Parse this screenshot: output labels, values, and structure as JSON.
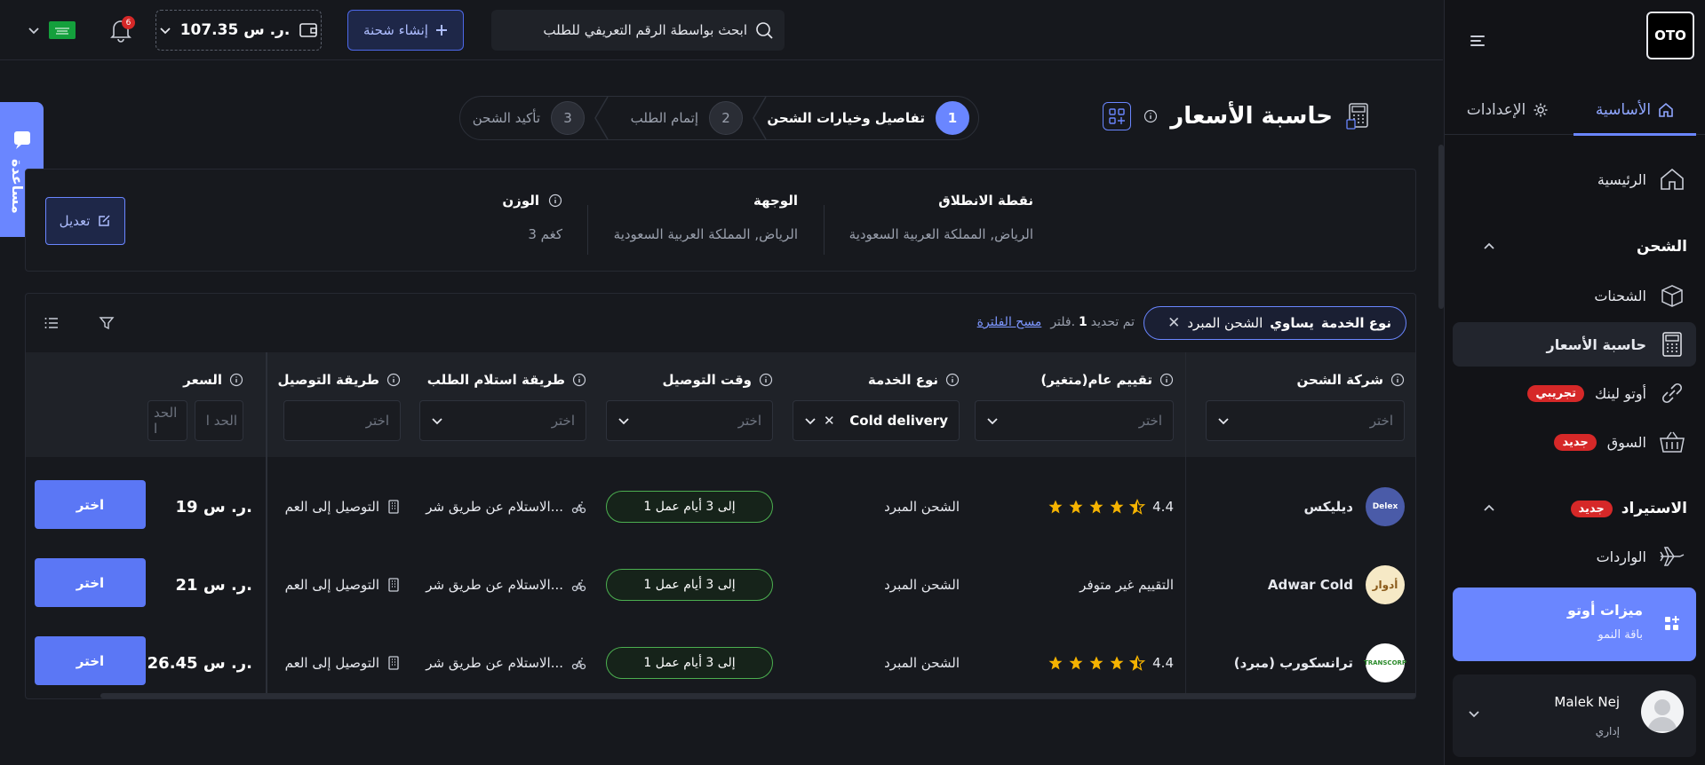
{
  "brand": {
    "logo_text": "OTO"
  },
  "sidebar": {
    "tabs": [
      {
        "label": "الأساسية",
        "icon": "home-icon",
        "active": true
      },
      {
        "label": "الإعدادات",
        "icon": "gear-icon",
        "active": false
      }
    ],
    "items": [
      {
        "label": "الرئيسية",
        "icon": "house-icon"
      },
      {
        "label": "الشحنات",
        "icon": "box-icon"
      },
      {
        "label": "حاسبة الأسعار",
        "icon": "calculator-icon",
        "active": true
      },
      {
        "label": "أوتو لينك",
        "icon": "link-icon",
        "badge": "تجريبي"
      },
      {
        "label": "السوق",
        "icon": "basket-icon",
        "badge": "جديد"
      },
      {
        "label": "الواردات",
        "icon": "plane-icon"
      }
    ],
    "sections": {
      "shipping": "الشحن",
      "import": "الاستيراد",
      "import_badge": "جديد"
    },
    "features_card": {
      "title": "ميزات أوتو",
      "subtitle": "باقة النمو"
    },
    "user": {
      "name": "Malek Nej",
      "role": "إداري"
    }
  },
  "topbar": {
    "search_placeholder": "ابحث بواسطة الرقم التعريفي للطلب",
    "create_label": "إنشاء شحنة",
    "wallet_balance": "107.35 ر. س.",
    "notification_count": "6"
  },
  "help": {
    "label": "مساعدة"
  },
  "page": {
    "title": "حاسبة الأسعار",
    "steps": [
      {
        "num": "1",
        "label": "تفاصيل وخيارات الشحن",
        "active": true
      },
      {
        "num": "2",
        "label": "إتمام الطلب",
        "active": false
      },
      {
        "num": "3",
        "label": "تأكيد الشحن",
        "active": false
      }
    ]
  },
  "route": {
    "origin_label": "نقطة الانطلاق",
    "origin_value": "الرياض, المملكة العربية السعودية",
    "destination_label": "الوجهة",
    "destination_value": "الرياض, المملكة العربية السعودية",
    "weight_label": "الوزن",
    "weight_value": "3 كغم",
    "edit_label": "تعديل"
  },
  "filters": {
    "chip_key": "نوع الخدمة",
    "chip_op": "يساوي",
    "chip_value": "الشحن المبرد",
    "info_pre": "تم تحديد",
    "info_count": "1",
    "info_post": "فلتر.",
    "clear_label": "مسح الفلترة"
  },
  "table": {
    "columns": {
      "carrier": "شركة الشحن",
      "rating": "تقييم عام(متغير)",
      "service": "نوع الخدمة",
      "delivery_time": "وقت التوصيل",
      "pickup": "طريقة استلام الطلب",
      "delivery_method": "طريقة التوصيل",
      "price": "السعر"
    },
    "placeholders": {
      "choose": "اختر",
      "min": "الحد ا",
      "max": "الحد ا"
    },
    "service_filter_value": "Cold delivery",
    "rows": [
      {
        "carrier": "ديليكس",
        "logo_text": "Delex",
        "logo_color": "#4a5ba8",
        "rating_text": "4.4",
        "stars": 4.5,
        "service": "الشحن المبرد",
        "time": "1 إلى 3 أيام عمل",
        "pickup": "الاستلام عن طريق شر...",
        "delivery": "التوصيل إلى العم",
        "price": "19 ر. س.",
        "action": "اختر"
      },
      {
        "carrier": "Adwar Cold",
        "logo_text": "أدوار",
        "logo_color": "#f6e9c6",
        "rating_text": "التقييم غير متوفر",
        "stars": 0,
        "service": "الشحن المبرد",
        "time": "1 إلى 3 أيام عمل",
        "pickup": "الاستلام عن طريق شر...",
        "delivery": "التوصيل إلى العم",
        "price": "21 ر. س.",
        "action": "اختر"
      },
      {
        "carrier": "ترانسكورب (مبرد)",
        "logo_text": "TRANSCORP",
        "logo_color": "#ffffff",
        "rating_text": "4.4",
        "stars": 4.5,
        "service": "الشحن المبرد",
        "time": "1 إلى 3 أيام عمل",
        "pickup": "الاستلام عن طريق شر...",
        "delivery": "التوصيل إلى العم",
        "price": "26.45 ر. س.",
        "action": "اختر"
      }
    ]
  },
  "colors": {
    "accent": "#6a86ff",
    "badge_red": "#d62828",
    "star": "#f5b301",
    "pill_border": "#4caf50"
  }
}
